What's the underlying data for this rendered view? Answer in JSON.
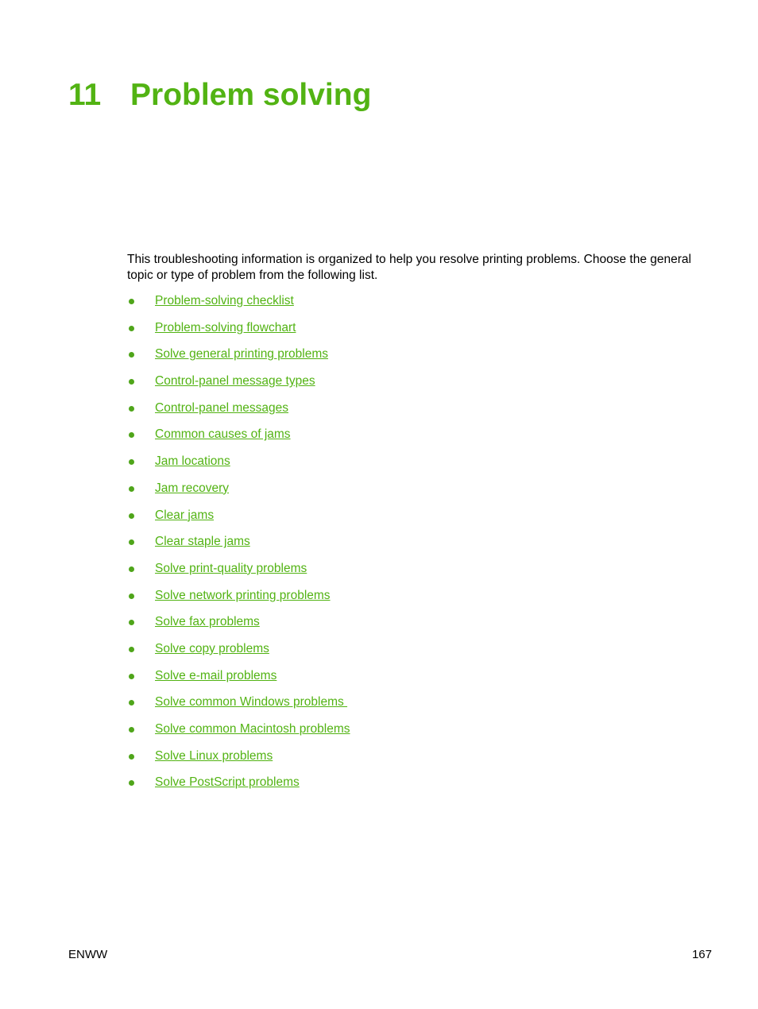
{
  "chapter": {
    "number": "11",
    "title": "Problem solving"
  },
  "intro": "This troubleshooting information is organized to help you resolve printing problems. Choose the general topic or type of problem from the following list.",
  "links": [
    "Problem-solving checklist",
    "Problem-solving flowchart",
    "Solve general printing problems",
    "Control-panel message types",
    "Control-panel messages",
    "Common causes of jams",
    "Jam locations",
    "Jam recovery",
    "Clear jams",
    "Clear staple jams",
    "Solve print-quality problems",
    "Solve network printing problems",
    "Solve fax problems",
    "Solve copy problems",
    "Solve e-mail problems",
    "Solve common Windows problems ",
    "Solve common Macintosh problems",
    "Solve Linux problems",
    "Solve PostScript problems"
  ],
  "footer": {
    "left": "ENWW",
    "page_number": "167"
  },
  "colors": {
    "accent": "#52b313"
  }
}
